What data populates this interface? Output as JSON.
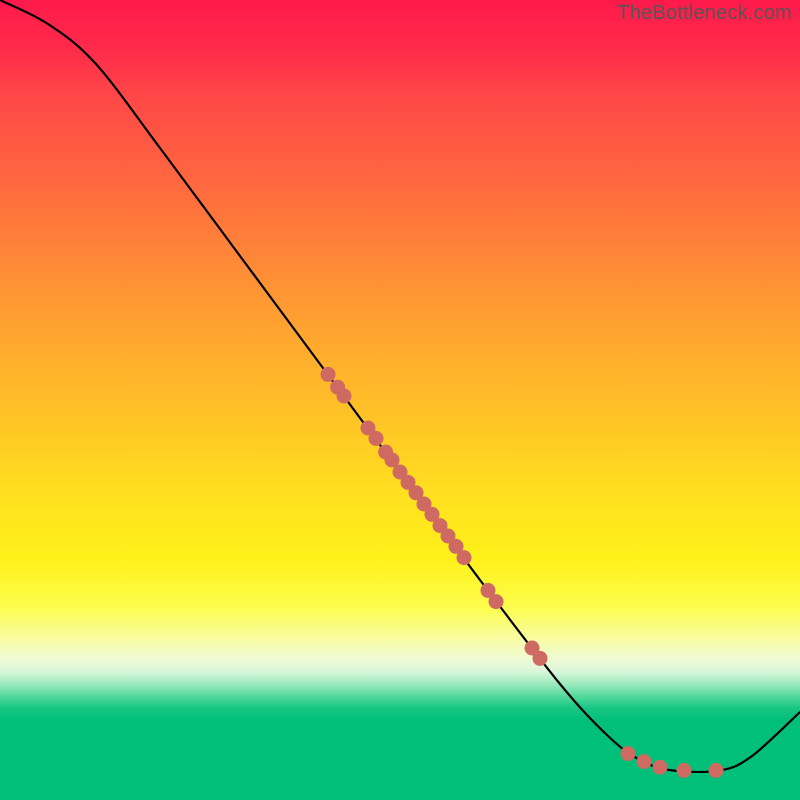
{
  "attribution": "TheBottleneck.com",
  "chart_data": {
    "type": "line",
    "title": "",
    "xlabel": "",
    "ylabel": "",
    "xlim": [
      0,
      100
    ],
    "ylim": [
      0,
      100
    ],
    "grid": false,
    "legend": false,
    "curve": [
      {
        "x": 0,
        "y": 100
      },
      {
        "x": 6,
        "y": 97
      },
      {
        "x": 12,
        "y": 92
      },
      {
        "x": 20,
        "y": 81.5
      },
      {
        "x": 30,
        "y": 68
      },
      {
        "x": 40,
        "y": 54.5
      },
      {
        "x": 50,
        "y": 41
      },
      {
        "x": 60,
        "y": 27.5
      },
      {
        "x": 70,
        "y": 14.5
      },
      {
        "x": 76,
        "y": 8
      },
      {
        "x": 80,
        "y": 5
      },
      {
        "x": 84,
        "y": 3.7
      },
      {
        "x": 90,
        "y": 3.7
      },
      {
        "x": 94,
        "y": 5.5
      },
      {
        "x": 100,
        "y": 11
      }
    ],
    "markers": [
      {
        "x": 41.0,
        "y": 53.2
      },
      {
        "x": 42.2,
        "y": 51.6
      },
      {
        "x": 43.0,
        "y": 50.5
      },
      {
        "x": 46.0,
        "y": 46.5
      },
      {
        "x": 47.0,
        "y": 45.2
      },
      {
        "x": 48.2,
        "y": 43.5
      },
      {
        "x": 49.0,
        "y": 42.5
      },
      {
        "x": 50.0,
        "y": 41.0
      },
      {
        "x": 51.0,
        "y": 39.7
      },
      {
        "x": 52.0,
        "y": 38.4
      },
      {
        "x": 53.0,
        "y": 37.0
      },
      {
        "x": 54.0,
        "y": 35.7
      },
      {
        "x": 55.0,
        "y": 34.3
      },
      {
        "x": 56.0,
        "y": 33.0
      },
      {
        "x": 57.0,
        "y": 31.7
      },
      {
        "x": 58.0,
        "y": 30.3
      },
      {
        "x": 61.0,
        "y": 26.2
      },
      {
        "x": 62.0,
        "y": 24.8
      },
      {
        "x": 66.5,
        "y": 19.0
      },
      {
        "x": 67.5,
        "y": 17.7
      },
      {
        "x": 78.5,
        "y": 5.8
      },
      {
        "x": 80.5,
        "y": 4.8
      },
      {
        "x": 82.5,
        "y": 4.1
      },
      {
        "x": 85.5,
        "y": 3.7
      },
      {
        "x": 89.5,
        "y": 3.7
      }
    ],
    "colors": {
      "line": "#000000",
      "marker_fill": "#cf6a62",
      "marker_stroke": "#b85a53"
    }
  }
}
